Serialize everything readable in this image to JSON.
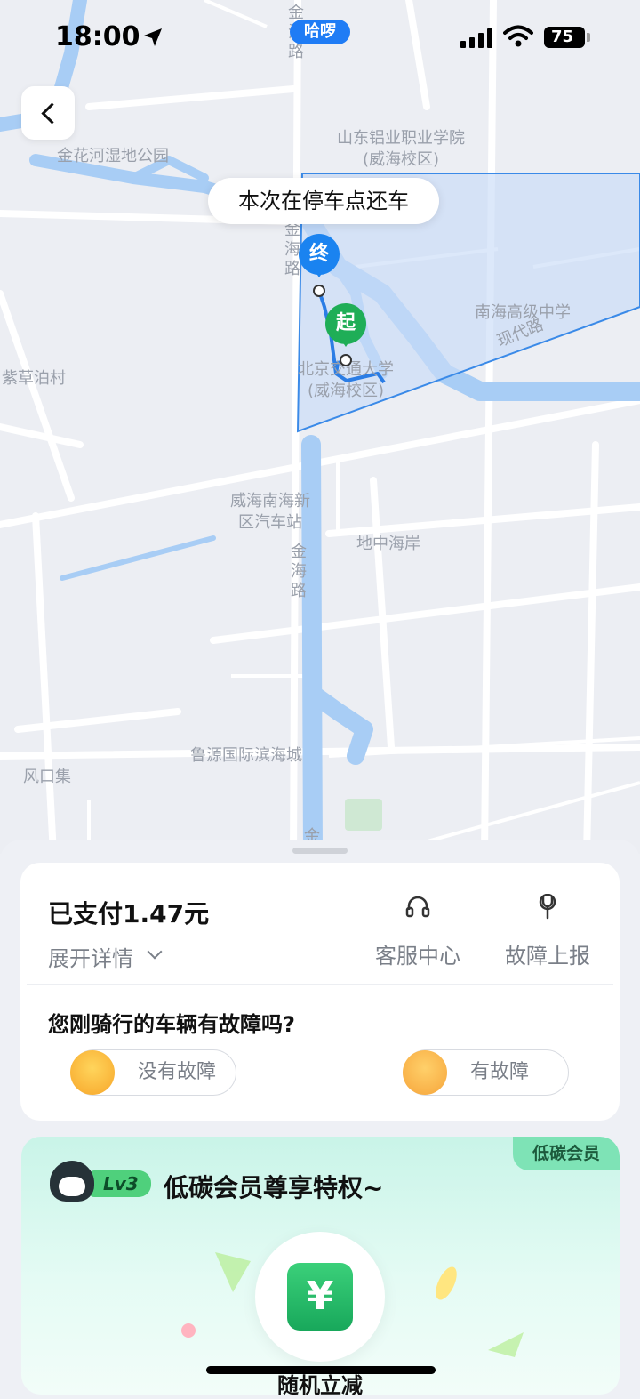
{
  "status_bar": {
    "time": "18:00",
    "app_pill": "哈啰",
    "battery": "75"
  },
  "map": {
    "tip": "本次在停车点还车",
    "labels": {
      "shandong": "山东铝业职业学院(威海校区)",
      "jinhua": "金花河湿地公园",
      "jinhai_top": "金海路",
      "jinhai_mid": "金海路",
      "jinhai_low": "金海路",
      "jinhai_bottom": "金",
      "nanhai_school": "南海高级中学",
      "xiandai": "现代路",
      "bjjt": "北京交通大学(威海校区)",
      "zicao": "紫草泊村",
      "weihai_bus": "威海南海新区汽车站",
      "dizhonghai": "地中海岸",
      "luyuan": "鲁源国际滨海城",
      "fengkou": "风口集"
    },
    "pins": {
      "end": "终",
      "start": "起"
    }
  },
  "trip_card": {
    "paid": "已支付1.47元",
    "expand": "展开详情",
    "service": "客服中心",
    "report": "故障上报",
    "question": "您刚骑行的车辆有故障吗?",
    "no_fault": "没有故障",
    "has_fault": "有故障"
  },
  "member": {
    "tag": "低碳会员",
    "level": "Lv3",
    "title": "低碳会员尊享特权~",
    "yen": "¥",
    "random": "随机立减"
  }
}
